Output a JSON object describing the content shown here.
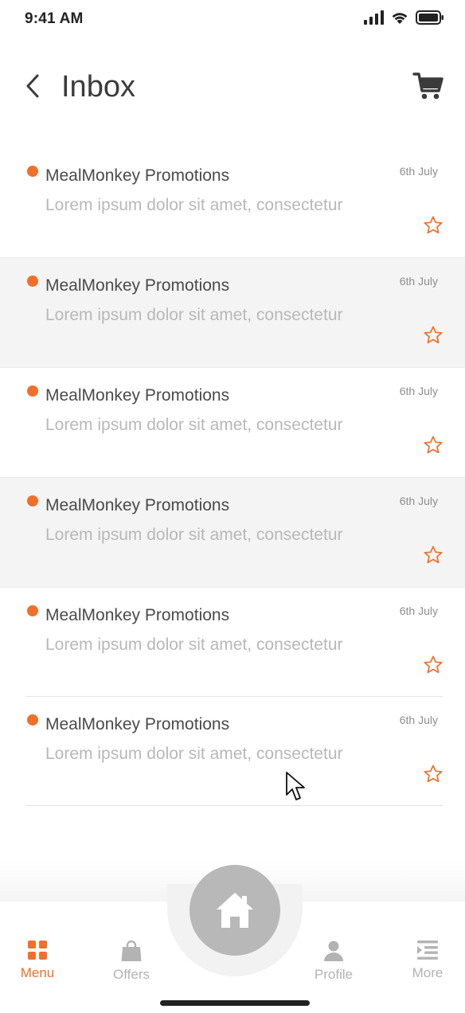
{
  "status_bar": {
    "time": "9:41 AM"
  },
  "header": {
    "title": "Inbox"
  },
  "colors": {
    "accent": "#f26f2a",
    "inactive": "#b3b3b3",
    "home_button": "#b8b8b8"
  },
  "messages": [
    {
      "sender": "MealMonkey Promotions",
      "preview": "Lorem ipsum dolor sit amet, consectetur",
      "date": "6th July"
    },
    {
      "sender": "MealMonkey Promotions",
      "preview": "Lorem ipsum dolor sit amet, consectetur",
      "date": "6th July"
    },
    {
      "sender": "MealMonkey Promotions",
      "preview": "Lorem ipsum dolor sit amet, consectetur",
      "date": "6th July"
    },
    {
      "sender": "MealMonkey Promotions",
      "preview": "Lorem ipsum dolor sit amet, consectetur",
      "date": "6th July"
    },
    {
      "sender": "MealMonkey Promotions",
      "preview": "Lorem ipsum dolor sit amet, consectetur",
      "date": "6th July"
    },
    {
      "sender": "MealMonkey Promotions",
      "preview": "Lorem ipsum dolor sit amet, consectetur",
      "date": "6th July"
    }
  ],
  "tab_bar": {
    "items": [
      {
        "label": "Menu",
        "icon": "grid-icon",
        "active": true
      },
      {
        "label": "Offers",
        "icon": "shopping-bag-icon",
        "active": false
      },
      {
        "label": "Profile",
        "icon": "person-icon",
        "active": false
      },
      {
        "label": "More",
        "icon": "menu-list-icon",
        "active": false
      }
    ],
    "center_icon": "home-icon"
  }
}
